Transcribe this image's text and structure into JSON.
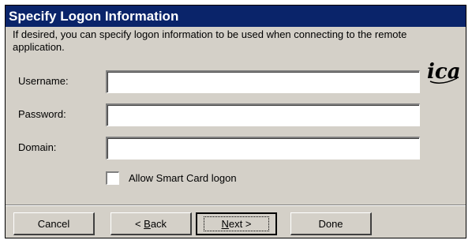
{
  "dialog": {
    "title": "Specify Logon Information",
    "description": "If desired, you can specify logon information to be used when connecting to the remote application.",
    "logo_text": "ica"
  },
  "form": {
    "username_label": "Username:",
    "username_value": "",
    "password_label": "Password:",
    "password_value": "",
    "domain_label": "Domain:",
    "domain_value": "",
    "smart_card_label": "Allow Smart Card logon",
    "smart_card_checked": false
  },
  "buttons": {
    "cancel": "Cancel",
    "back_prefix": "< ",
    "back_mnemonic": "B",
    "back_rest": "ack",
    "next_mnemonic": "N",
    "next_rest": "ext >",
    "done": "Done"
  },
  "colors": {
    "titlebar": "#0a246a",
    "dialog_bg": "#d4d0c8"
  }
}
